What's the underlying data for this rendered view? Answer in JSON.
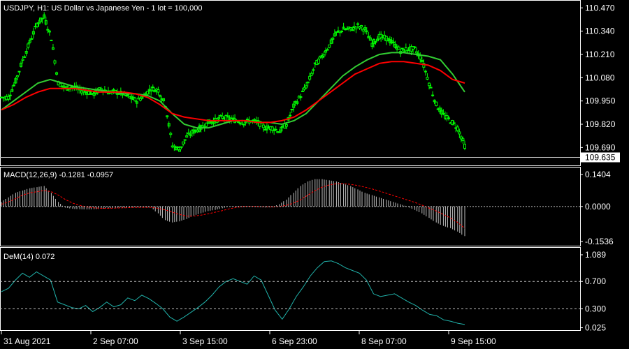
{
  "header": {
    "symbol_title": "USDJPY, H1:  US Dollar vs Japanese Yen - 1 lot = 100,000",
    "macd_title": "MACD(12,26,9) -0.1281 -0.0957",
    "dem_title": "DeM(14) 0.072"
  },
  "colors": {
    "background": "#000000",
    "frame": "#ffffff",
    "candles": "#00ff00",
    "ma_fast": "#32cd32",
    "ma_slow": "#ff0000",
    "macd_hist": "#c0c0c0",
    "macd_signal": "#ff0000",
    "dem_line": "#20b2aa",
    "level_lines": "#c0c0c0"
  },
  "chart_data": [
    {
      "type": "candlestick",
      "panel": "price",
      "title": "USDJPY, H1:  US Dollar vs Japanese Yen - 1 lot = 100,000",
      "ylim": [
        109.59,
        110.51
      ],
      "y_ticks": [
        "110.470",
        "110.340",
        "110.210",
        "110.080",
        "109.950",
        "109.820",
        "109.690"
      ],
      "current_price": "109.635",
      "close_series_sketch": [
        109.97,
        110.06,
        110.18,
        110.28,
        110.38,
        110.42,
        110.3,
        110.05,
        110.02,
        110.03,
        110.01,
        110.0,
        109.99,
        110.02,
        110.0,
        110.0,
        109.99,
        109.97,
        109.95,
        109.98,
        110.02,
        110.01,
        109.93,
        109.7,
        109.68,
        109.75,
        109.78,
        109.8,
        109.83,
        109.84,
        109.86,
        109.85,
        109.84,
        109.83,
        109.84,
        109.83,
        109.8,
        109.8,
        109.78,
        109.82,
        109.92,
        109.98,
        110.05,
        110.15,
        110.2,
        110.26,
        110.33,
        110.35,
        110.35,
        110.37,
        110.35,
        110.27,
        110.31,
        110.3,
        110.27,
        110.23,
        110.24,
        110.24,
        110.18,
        110.05,
        109.93,
        109.87,
        109.84,
        109.8,
        109.7,
        109.64
      ],
      "moving_averages": [
        {
          "color": "ma_fast",
          "values": [
            109.9,
            109.95,
            110.0,
            110.05,
            110.07,
            110.05,
            110.03,
            110.02,
            110.01,
            110.0,
            109.99,
            109.99,
            109.98,
            109.95,
            109.88,
            109.82,
            109.8,
            109.8,
            109.82,
            109.84,
            109.84,
            109.83,
            109.83,
            109.82,
            109.84,
            109.88,
            109.95,
            110.02,
            110.09,
            110.14,
            110.18,
            110.21,
            110.22,
            110.22,
            110.21,
            110.2,
            110.18,
            110.1,
            110.0
          ]
        },
        {
          "color": "ma_slow",
          "values": [
            109.9,
            109.93,
            109.97,
            110.0,
            110.02,
            110.02,
            110.02,
            110.01,
            110.0,
            110.0,
            110.0,
            109.99,
            109.97,
            109.93,
            109.88,
            109.86,
            109.85,
            109.84,
            109.84,
            109.84,
            109.84,
            109.83,
            109.83,
            109.84,
            109.86,
            109.9,
            109.95,
            110.0,
            110.05,
            110.1,
            110.13,
            110.16,
            110.17,
            110.17,
            110.16,
            110.15,
            110.12,
            110.07,
            110.05
          ]
        }
      ]
    },
    {
      "type": "bar",
      "panel": "macd",
      "title": "MACD(12,26,9) -0.1281 -0.0957",
      "ylim": [
        -0.1536,
        0.1404
      ],
      "y_ticks": [
        "0.1404",
        "0.0000",
        "-0.1536"
      ],
      "histogram": [
        0.02,
        0.04,
        0.06,
        0.07,
        0.08,
        0.085,
        0.09,
        0.06,
        0.02,
        -0.005,
        -0.01,
        -0.012,
        -0.013,
        -0.012,
        -0.01,
        -0.008,
        -0.006,
        -0.005,
        -0.005,
        -0.003,
        -0.004,
        -0.004,
        -0.03,
        -0.06,
        -0.07,
        -0.065,
        -0.055,
        -0.04,
        -0.03,
        -0.02,
        -0.015,
        -0.008,
        0.0,
        0.002,
        0.002,
        0.001,
        -0.002,
        -0.004,
        -0.003,
        0.01,
        0.03,
        0.06,
        0.09,
        0.11,
        0.12,
        0.12,
        0.115,
        0.11,
        0.1,
        0.09,
        0.075,
        0.06,
        0.05,
        0.04,
        0.03,
        0.02,
        0.01,
        0.0,
        -0.015,
        -0.03,
        -0.05,
        -0.07,
        -0.085,
        -0.095,
        -0.11,
        -0.13
      ],
      "signal": [
        0.01,
        0.02,
        0.035,
        0.05,
        0.06,
        0.065,
        0.07,
        0.065,
        0.05,
        0.03,
        0.015,
        0.005,
        -0.002,
        -0.006,
        -0.008,
        -0.008,
        -0.007,
        -0.006,
        -0.005,
        -0.004,
        -0.004,
        -0.004,
        -0.008,
        -0.015,
        -0.025,
        -0.035,
        -0.042,
        -0.042,
        -0.038,
        -0.032,
        -0.025,
        -0.018,
        -0.01,
        -0.004,
        0.0,
        0.001,
        0.0,
        -0.001,
        -0.002,
        0.0,
        0.005,
        0.015,
        0.03,
        0.05,
        0.07,
        0.085,
        0.095,
        0.1,
        0.1,
        0.097,
        0.092,
        0.085,
        0.077,
        0.068,
        0.058,
        0.048,
        0.038,
        0.028,
        0.018,
        0.006,
        -0.007,
        -0.02,
        -0.035,
        -0.05,
        -0.07,
        -0.0957
      ]
    },
    {
      "type": "line",
      "panel": "demarker",
      "title": "DeM(14) 0.072",
      "ylim": [
        0.0,
        1.089
      ],
      "y_ticks": [
        "1.089",
        "0.700",
        "0.300",
        "0.025"
      ],
      "levels": [
        0.7,
        0.3
      ],
      "values": [
        0.55,
        0.6,
        0.72,
        0.82,
        0.76,
        0.84,
        0.78,
        0.72,
        0.4,
        0.36,
        0.32,
        0.3,
        0.35,
        0.26,
        0.32,
        0.4,
        0.33,
        0.36,
        0.46,
        0.42,
        0.5,
        0.45,
        0.38,
        0.3,
        0.18,
        0.12,
        0.18,
        0.25,
        0.32,
        0.4,
        0.5,
        0.62,
        0.7,
        0.74,
        0.7,
        0.66,
        0.78,
        0.72,
        0.5,
        0.28,
        0.15,
        0.3,
        0.48,
        0.62,
        0.78,
        0.9,
        0.99,
        1.0,
        0.96,
        0.9,
        0.86,
        0.82,
        0.72,
        0.52,
        0.48,
        0.5,
        0.52,
        0.46,
        0.4,
        0.35,
        0.28,
        0.22,
        0.2,
        0.14,
        0.12,
        0.09,
        0.072
      ]
    }
  ],
  "x_axis": {
    "labels": [
      "31 Aug 2021",
      "2 Sep 07:00",
      "3 Sep 15:00",
      "6 Sep 23:00",
      "8 Sep 07:00",
      "9 Sep 15:00"
    ]
  }
}
